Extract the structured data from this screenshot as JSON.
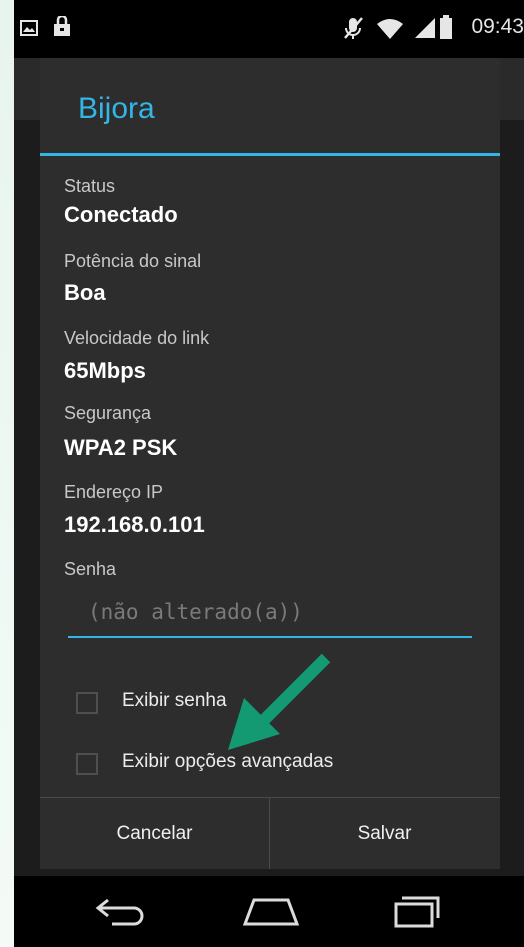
{
  "status_bar": {
    "time": "09:43",
    "icons": [
      "screenshot-icon",
      "bag-icon",
      "mute-icon",
      "wifi-icon",
      "signal-icon",
      "battery-icon"
    ]
  },
  "dialog": {
    "title": "Bijora",
    "fields": [
      {
        "label": "Status",
        "value": "Conectado"
      },
      {
        "label": "Potência do sinal",
        "value": "Boa"
      },
      {
        "label": "Velocidade do link",
        "value": "65Mbps"
      },
      {
        "label": "Segurança",
        "value": "WPA2 PSK"
      },
      {
        "label": "Endereço IP",
        "value": "192.168.0.101"
      }
    ],
    "password_label": "Senha",
    "password_placeholder": "(não alterado(a))",
    "checkboxes": [
      {
        "label": "Exibir senha",
        "checked": false
      },
      {
        "label": "Exibir opções avançadas",
        "checked": false
      }
    ],
    "cancel_label": "Cancelar",
    "save_label": "Salvar"
  },
  "navigation": {
    "icons": [
      "back-icon",
      "home-icon",
      "recents-icon"
    ]
  },
  "colors": {
    "accent": "#33b5e5",
    "annotation_arrow": "#139a73"
  }
}
